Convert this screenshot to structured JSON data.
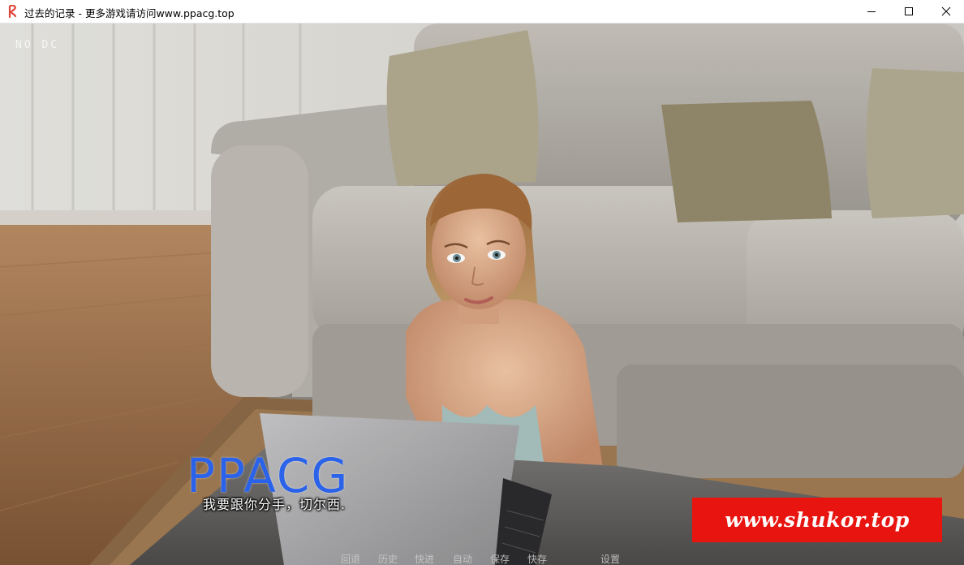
{
  "window": {
    "title": "过去的记录 - 更多游戏请访问www.ppacg.top"
  },
  "hud": {
    "status_text": "NO DC"
  },
  "watermarks": {
    "ppacg": "PPACG",
    "shukor": "www.shukor.top",
    "shukor_bg_color": "#e8140f",
    "ppacg_color": "#2a62ea"
  },
  "dialogue": {
    "text": "我要跟你分手，切尔西."
  },
  "quick_menu": {
    "items": [
      "回退",
      "历史",
      "快进",
      "自动",
      "保存",
      "快存",
      "设置"
    ]
  },
  "icons": {
    "app": "app-logo-icon",
    "minimize": "minimize-icon",
    "maximize": "maximize-icon",
    "close": "close-icon"
  }
}
